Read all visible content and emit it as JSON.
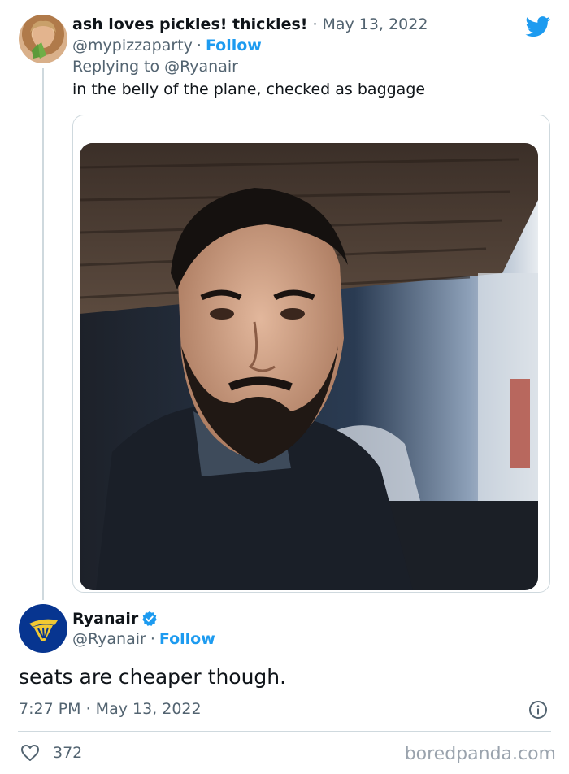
{
  "tweet1": {
    "display_name": "ash loves pickles! thickles!",
    "date": "May 13, 2022",
    "handle": "@mypizzaparty",
    "follow": "Follow",
    "replying_label": "Replying to",
    "reply_to": "@Ryanair",
    "text": "in the belly of the plane, checked as baggage"
  },
  "tweet2": {
    "display_name": "Ryanair",
    "handle": "@Ryanair",
    "follow": "Follow",
    "text": "seats are cheaper though.",
    "timestamp": "7:27 PM · May 13, 2022",
    "likes": "372"
  },
  "watermark": "boredpanda.com",
  "icons": {
    "platform": "twitter-bird-icon",
    "verified": "verified-badge-icon",
    "info": "info-icon",
    "like": "heart-icon"
  },
  "colors": {
    "accent": "#1d9bf0",
    "text": "#0f1419",
    "muted": "#536471",
    "border": "#cfd9de",
    "ryanair_navy": "#073590",
    "ryanair_gold": "#f1c933"
  }
}
